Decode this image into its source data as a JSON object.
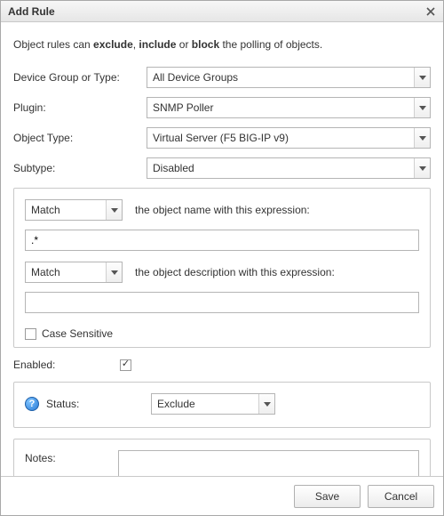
{
  "title": "Add Rule",
  "intro": {
    "prefix": "Object rules can ",
    "w1": "exclude",
    "sep1": ", ",
    "w2": "include",
    "sep2": " or ",
    "w3": "block",
    "suffix": " the polling of objects."
  },
  "fields": {
    "device_group": {
      "label": "Device Group or Type:",
      "value": "All Device Groups"
    },
    "plugin": {
      "label": "Plugin:",
      "value": "SNMP Poller"
    },
    "object_type": {
      "label": "Object Type:",
      "value": "Virtual Server (F5 BIG-IP v9)"
    },
    "subtype": {
      "label": "Subtype:",
      "value": "Disabled"
    }
  },
  "match": {
    "mode1": "Match",
    "text1": "the object name with this expression:",
    "expr1": ".*",
    "mode2": "Match",
    "text2": "the object description with this expression:",
    "expr2": "",
    "case_label": "Case Sensitive",
    "case_checked": false
  },
  "enabled": {
    "label": "Enabled:",
    "checked": true
  },
  "status": {
    "label": "Status:",
    "value": "Exclude",
    "help": "?"
  },
  "notes": {
    "label": "Notes:",
    "value": ""
  },
  "buttons": {
    "save": "Save",
    "cancel": "Cancel"
  }
}
